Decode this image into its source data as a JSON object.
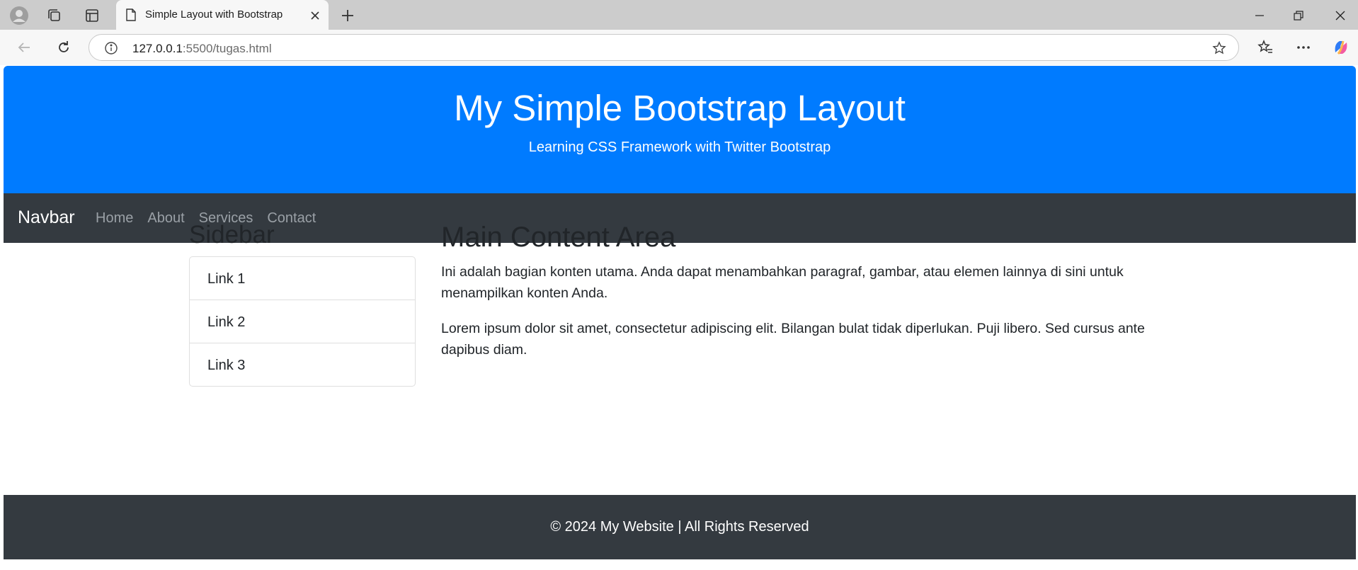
{
  "browser": {
    "tab_title": "Simple Layout with Bootstrap",
    "url_host": "127.0.0.1",
    "url_rest": ":5500/tugas.html"
  },
  "page": {
    "header": {
      "title": "My Simple Bootstrap Layout",
      "subtitle": "Learning CSS Framework with Twitter Bootstrap"
    },
    "navbar": {
      "brand": "Navbar",
      "links": [
        "Home",
        "About",
        "Services",
        "Contact"
      ]
    },
    "sidebar": {
      "title": "Sidebar",
      "links": [
        "Link 1",
        "Link 2",
        "Link 3"
      ]
    },
    "main": {
      "title": "Main Content Area",
      "paragraphs": [
        "Ini adalah bagian konten utama. Anda dapat menambahkan paragraf, gambar, atau elemen lainnya di sini untuk menampilkan konten Anda.",
        "Lorem ipsum dolor sit amet, consectetur adipiscing elit. Bilangan bulat tidak diperlukan. Puji libero. Sed cursus ante dapibus diam."
      ]
    },
    "footer": {
      "text": "© 2024 My Website | All Rights Reserved"
    }
  },
  "colors": {
    "primary": "#007bff",
    "dark": "#343a40"
  }
}
